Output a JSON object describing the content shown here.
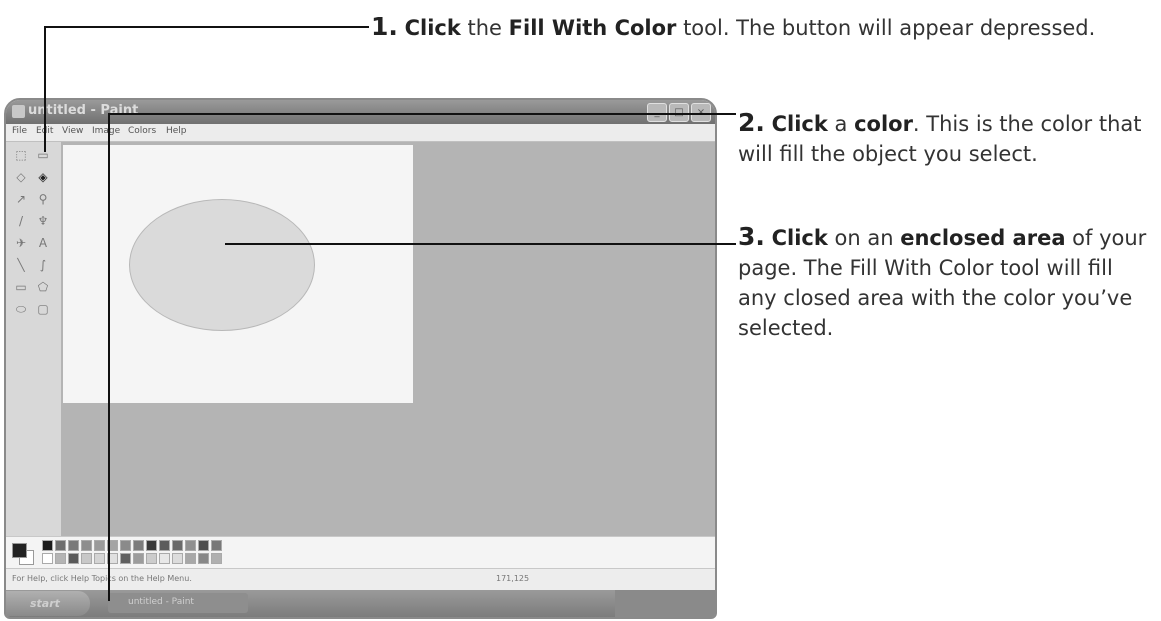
{
  "callouts": {
    "step1": {
      "num": "1.",
      "b1": "Click",
      "t1": " the ",
      "b2": "Fill With Color",
      "t2": " tool. The button will appear depressed."
    },
    "step2": {
      "num": "2.",
      "b1": "Click",
      "t1": " a ",
      "b2": "color",
      "t2": ". This is the color that will fill the object you select."
    },
    "step3": {
      "num": "3.",
      "b1": "Click",
      "t1": " on an ",
      "b2": "enclosed area",
      "t2": " of your page. The Fill With Color tool will fill any closed area with the color you’ve selected."
    }
  },
  "window": {
    "title": "untitled - Paint",
    "menus": [
      "File",
      "Edit",
      "View",
      "Image",
      "Colors",
      "Help"
    ],
    "status_text": "For Help, click Help Topics on the Help Menu.",
    "status_coords": "171,125",
    "taskbar": {
      "start": "start",
      "task": "untitled - Paint",
      "clock": ""
    }
  },
  "tools": [
    {
      "name": "free-select-icon",
      "glyph": "⬚"
    },
    {
      "name": "select-icon",
      "glyph": "▭"
    },
    {
      "name": "eraser-icon",
      "glyph": "◇"
    },
    {
      "name": "fill-with-color-icon",
      "glyph": "◈"
    },
    {
      "name": "pick-color-icon",
      "glyph": "↗"
    },
    {
      "name": "magnifier-icon",
      "glyph": "⚲"
    },
    {
      "name": "pencil-icon",
      "glyph": "/"
    },
    {
      "name": "brush-icon",
      "glyph": "♆"
    },
    {
      "name": "airbrush-icon",
      "glyph": "✈"
    },
    {
      "name": "text-icon",
      "glyph": "A"
    },
    {
      "name": "line-icon",
      "glyph": "╲"
    },
    {
      "name": "curve-icon",
      "glyph": "∫"
    },
    {
      "name": "rectangle-icon",
      "glyph": "▭"
    },
    {
      "name": "polygon-icon",
      "glyph": "⬠"
    },
    {
      "name": "ellipse-icon",
      "glyph": "⬭"
    },
    {
      "name": "rounded-rect-icon",
      "glyph": "▢"
    }
  ],
  "palette_top": [
    "#1a1a1a",
    "#6e6e6e",
    "#7a7a7a",
    "#8e8e8e",
    "#9a9a9a",
    "#a4a4a4",
    "#8a8a8a",
    "#7c7c7c",
    "#3a3a3a",
    "#5c5c5c",
    "#6a6a6a",
    "#909090",
    "#4e4e4e",
    "#787878"
  ],
  "palette_bottom": [
    "#ffffff",
    "#b4b4b4",
    "#5a5a5a",
    "#c8c8c8",
    "#d4d4d4",
    "#e0e0e0",
    "#606060",
    "#9c9c9c",
    "#cccccc",
    "#e8e8e8",
    "#dcdcdc",
    "#a8a8a8",
    "#888888",
    "#b0b0b0"
  ]
}
